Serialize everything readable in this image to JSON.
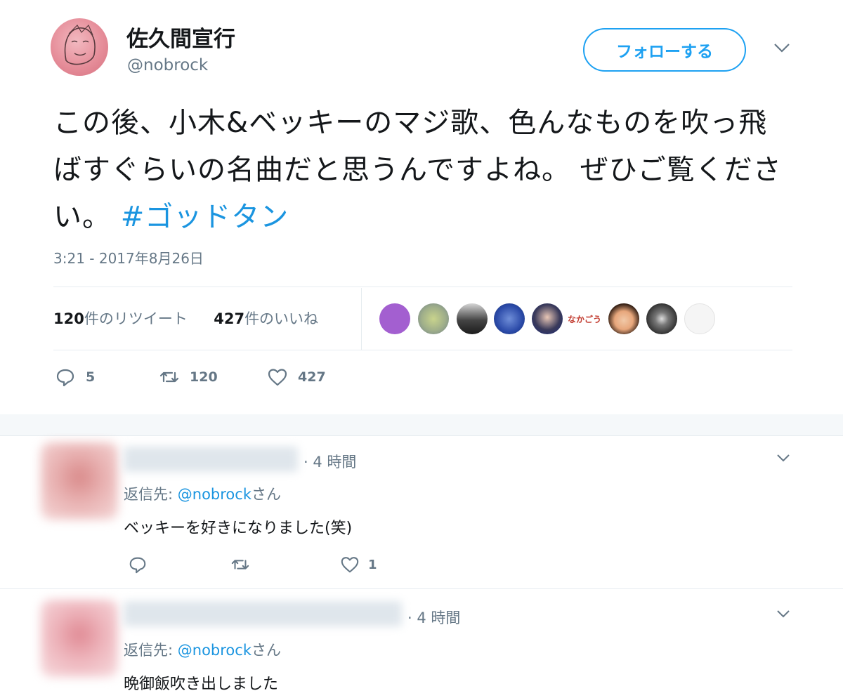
{
  "author": {
    "name": "佐久間宣行",
    "handle": "@nobrock"
  },
  "follow_button": "フォローする",
  "tweet": {
    "text": "この後、小木&ベッキーのマジ歌、色んなものを吹っ飛ばすぐらいの名曲だと思うんですよね。 ぜひご覧ください。 ",
    "hashtag": "#ゴッドタン",
    "timestamp": "3:21 - 2017年8月26日"
  },
  "stats": {
    "retweets_count": "120",
    "retweets_label": "件のリツイート",
    "likes_count": "427",
    "likes_label": "件のいいね"
  },
  "actions": {
    "replies": "5",
    "retweets": "120",
    "likes": "427"
  },
  "likers_small_text": "なかごう",
  "replies": [
    {
      "time": "· 4 時間",
      "reply_to_prefix": "返信先: ",
      "mention": "@nobrock",
      "mention_suffix": "さん",
      "text": "ベッキーを好きになりました(笑)",
      "likes": "1"
    },
    {
      "time": "· 4 時間",
      "reply_to_prefix": "返信先: ",
      "mention": "@nobrock",
      "mention_suffix": "さん",
      "text": "晩御飯吹き出しました"
    }
  ],
  "colors": {
    "accent": "#1da1f2",
    "hashtag": "#1b95e0",
    "muted": "#657786"
  }
}
